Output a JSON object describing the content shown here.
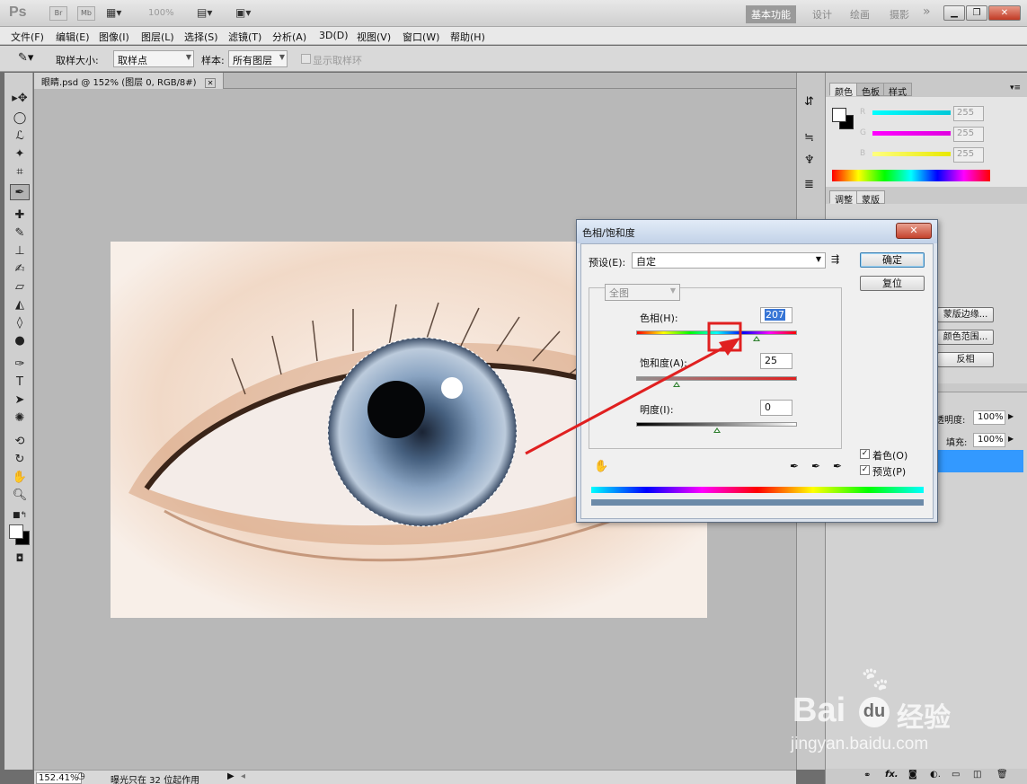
{
  "app": {
    "logo": "Ps",
    "title_buttons": [
      "Br",
      "Mb"
    ],
    "zoom": "100%",
    "workspaces": [
      "基本功能",
      "设计",
      "绘画",
      "摄影"
    ],
    "workspace_more": "»"
  },
  "menu": [
    "文件(F)",
    "编辑(E)",
    "图像(I)",
    "图层(L)",
    "选择(S)",
    "滤镜(T)",
    "分析(A)",
    "3D(D)",
    "视图(V)",
    "窗口(W)",
    "帮助(H)"
  ],
  "options": {
    "sample_size_label": "取样大小:",
    "sample_size_value": "取样点",
    "sample_label": "样本:",
    "sample_value": "所有图层",
    "show_ring_label": "显示取样环"
  },
  "document": {
    "tab_title": "眼睛.psd @ 152% (图层 0, RGB/8#)",
    "status_zoom": "152.41%",
    "status_text": "曝光只在 32 位起作用"
  },
  "color_panel": {
    "tabs": [
      "颜色",
      "色板",
      "样式"
    ],
    "channels": [
      {
        "label": "R",
        "value": "255",
        "color": "#00c8d8"
      },
      {
        "label": "G",
        "value": "255",
        "color": "#e000e0"
      },
      {
        "label": "B",
        "value": "255",
        "color": "#e8e800"
      }
    ]
  },
  "adjust_panel": {
    "tabs": [
      "调整",
      "蒙版"
    ],
    "buttons": [
      "蒙版边缘...",
      "颜色范围...",
      "反相"
    ]
  },
  "layers_panel": {
    "opacity_label": "透明度:",
    "opacity_value": "100%",
    "fill_label": "填充:",
    "fill_value": "100%"
  },
  "dialog": {
    "title": "色相/饱和度",
    "preset_label": "预设(E):",
    "preset_value": "自定",
    "ok_label": "确定",
    "reset_label": "复位",
    "channel_value": "全图",
    "hue_label": "色相(H):",
    "hue_value": "207",
    "hue_fraction": 0.75,
    "saturation_label": "饱和度(A):",
    "saturation_value": "25",
    "saturation_fraction": 0.25,
    "lightness_label": "明度(I):",
    "lightness_value": "0",
    "lightness_fraction": 0.5,
    "colorize_label": "着色(O)",
    "colorize_checked": true,
    "preview_label": "预览(P)",
    "preview_checked": true
  },
  "watermark": {
    "brand": "Bai",
    "brand_cn": "经验",
    "url": "jingyan.baidu.com"
  },
  "annotation_color": "#e02020"
}
